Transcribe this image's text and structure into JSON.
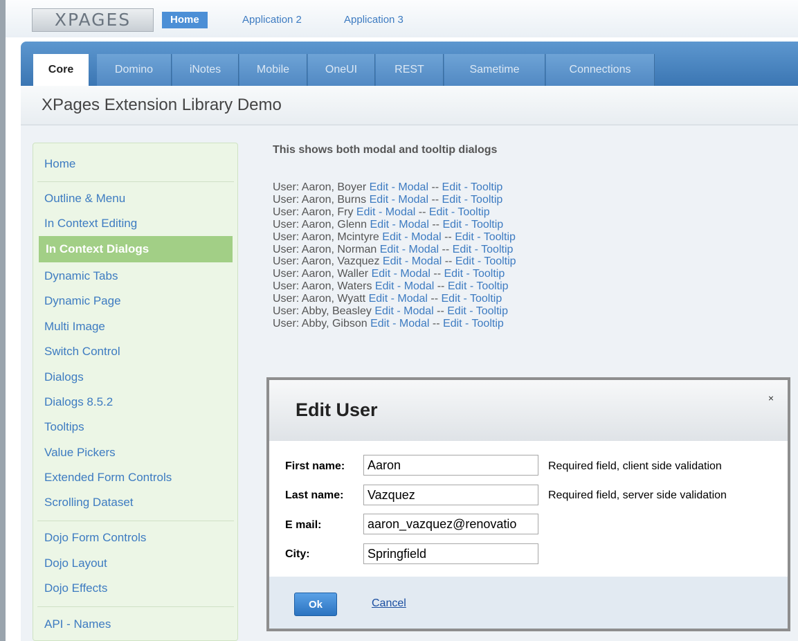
{
  "header": {
    "logo_text": "XPAGES",
    "app_tabs": [
      "Home",
      "Application 2",
      "Application 3"
    ]
  },
  "lib_tabs": [
    "Core",
    "Domino",
    "iNotes",
    "Mobile",
    "OneUI",
    "REST",
    "Sametime",
    "Connections"
  ],
  "page_title": "XPages Extension Library Demo",
  "sidebar": {
    "items": [
      "Home",
      "Outline & Menu",
      "In Context Editing",
      "In Context Dialogs",
      "Dynamic Tabs",
      "Dynamic Page",
      "Multi Image",
      "Switch Control",
      "Dialogs",
      "Dialogs 8.5.2",
      "Tooltips",
      "Value Pickers",
      "Extended Form Controls",
      "Scrolling Dataset",
      "Dojo Form Controls",
      "Dojo Layout",
      "Dojo Effects",
      "API - Names"
    ],
    "active": "In Context Dialogs"
  },
  "main": {
    "intro": "This shows both modal and tooltip dialogs",
    "user_prefix": "User:",
    "modal_link": "Edit - Modal",
    "separator": "--",
    "tooltip_link": "Edit - Tooltip",
    "users": [
      "Aaron, Boyer",
      "Aaron, Burns",
      "Aaron, Fry",
      "Aaron, Glenn",
      "Aaron, Mcintyre",
      "Aaron, Norman",
      "Aaron, Vazquez",
      "Aaron, Waller",
      "Aaron, Waters",
      "Aaron, Wyatt",
      "Abby, Beasley",
      "Abby, Gibson"
    ]
  },
  "dialog": {
    "title": "Edit User",
    "close": "×",
    "fields": [
      {
        "label": "First name:",
        "value": "Aaron",
        "hint": "Required field, client side validation"
      },
      {
        "label": "Last name:",
        "value": "Vazquez",
        "hint": "Required field, server side validation"
      },
      {
        "label": "E mail:",
        "value": "aaron_vazquez@renovatio",
        "hint": ""
      },
      {
        "label": "City:",
        "value": "Springfield",
        "hint": ""
      }
    ],
    "ok_label": "Ok",
    "cancel_label": "Cancel"
  }
}
